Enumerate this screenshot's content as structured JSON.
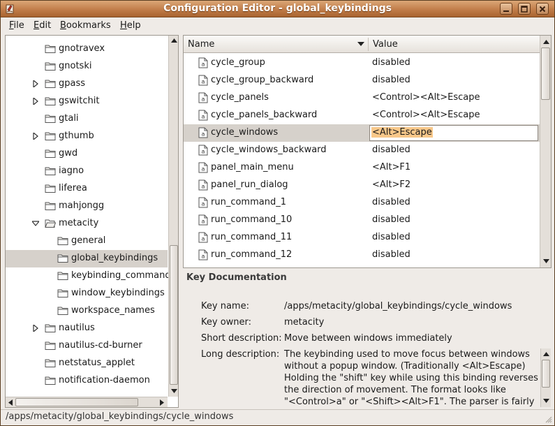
{
  "window": {
    "title": "Configuration Editor - global_keybindings"
  },
  "menubar": [
    {
      "mnemonic": "F",
      "rest": "ile"
    },
    {
      "mnemonic": "E",
      "rest": "dit"
    },
    {
      "mnemonic": "B",
      "rest": "ookmarks"
    },
    {
      "mnemonic": "H",
      "rest": "elp"
    }
  ],
  "tree": [
    {
      "label": "gnotravex",
      "level": 1,
      "expander": "none",
      "open": false,
      "selected": false
    },
    {
      "label": "gnotski",
      "level": 1,
      "expander": "none",
      "open": false,
      "selected": false
    },
    {
      "label": "gpass",
      "level": 1,
      "expander": "collapsed",
      "open": false,
      "selected": false
    },
    {
      "label": "gswitchit",
      "level": 1,
      "expander": "collapsed",
      "open": false,
      "selected": false
    },
    {
      "label": "gtali",
      "level": 1,
      "expander": "none",
      "open": false,
      "selected": false
    },
    {
      "label": "gthumb",
      "level": 1,
      "expander": "collapsed",
      "open": false,
      "selected": false
    },
    {
      "label": "gwd",
      "level": 1,
      "expander": "none",
      "open": false,
      "selected": false
    },
    {
      "label": "iagno",
      "level": 1,
      "expander": "none",
      "open": false,
      "selected": false
    },
    {
      "label": "liferea",
      "level": 1,
      "expander": "none",
      "open": false,
      "selected": false
    },
    {
      "label": "mahjongg",
      "level": 1,
      "expander": "none",
      "open": false,
      "selected": false
    },
    {
      "label": "metacity",
      "level": 1,
      "expander": "expanded",
      "open": true,
      "selected": false
    },
    {
      "label": "general",
      "level": 2,
      "expander": "none",
      "open": false,
      "selected": false
    },
    {
      "label": "global_keybindings",
      "level": 2,
      "expander": "none",
      "open": false,
      "selected": true
    },
    {
      "label": "keybinding_commands",
      "level": 2,
      "expander": "none",
      "open": false,
      "selected": false
    },
    {
      "label": "window_keybindings",
      "level": 2,
      "expander": "none",
      "open": false,
      "selected": false
    },
    {
      "label": "workspace_names",
      "level": 2,
      "expander": "none",
      "open": false,
      "selected": false
    },
    {
      "label": "nautilus",
      "level": 1,
      "expander": "collapsed",
      "open": false,
      "selected": false
    },
    {
      "label": "nautilus-cd-burner",
      "level": 1,
      "expander": "none",
      "open": false,
      "selected": false
    },
    {
      "label": "netstatus_applet",
      "level": 1,
      "expander": "none",
      "open": false,
      "selected": false
    },
    {
      "label": "notification-daemon",
      "level": 1,
      "expander": "none",
      "open": false,
      "selected": false
    }
  ],
  "list": {
    "columns": {
      "name": "Name",
      "value": "Value"
    },
    "rows": [
      {
        "name": "cycle_group",
        "value": "disabled",
        "selected": false
      },
      {
        "name": "cycle_group_backward",
        "value": "disabled",
        "selected": false
      },
      {
        "name": "cycle_panels",
        "value": "<Control><Alt>Escape",
        "selected": false
      },
      {
        "name": "cycle_panels_backward",
        "value": "<Control><Alt>Escape",
        "selected": false
      },
      {
        "name": "cycle_windows",
        "value": "<Alt>Escape",
        "selected": true
      },
      {
        "name": "cycle_windows_backward",
        "value": "disabled",
        "selected": false
      },
      {
        "name": "panel_main_menu",
        "value": "<Alt>F1",
        "selected": false
      },
      {
        "name": "panel_run_dialog",
        "value": "<Alt>F2",
        "selected": false
      },
      {
        "name": "run_command_1",
        "value": "disabled",
        "selected": false
      },
      {
        "name": "run_command_10",
        "value": "disabled",
        "selected": false
      },
      {
        "name": "run_command_11",
        "value": "disabled",
        "selected": false
      },
      {
        "name": "run_command_12",
        "value": "disabled",
        "selected": false
      }
    ]
  },
  "doc": {
    "title": "Key Documentation",
    "key_name_label": "Key name:",
    "key_name": "/apps/metacity/global_keybindings/cycle_windows",
    "key_owner_label": "Key owner:",
    "key_owner": "metacity",
    "short_desc_label": "Short description:",
    "short_desc": "Move between windows immediately",
    "long_desc_label": "Long description:",
    "long_desc_lines": [
      "The keybinding used to move focus between windows",
      "without a popup window. (Traditionally <Alt>Escape)",
      "Holding the \"shift\" key while using this binding reverses",
      "the direction of movement. The format looks like",
      "\"<Control>a\" or \"<Shift><Alt>F1\". The parser is fairly"
    ]
  },
  "status": "/apps/metacity/global_keybindings/cycle_windows",
  "colors": {
    "titlebar": "#c17d4a",
    "selection": "#d6d1cb",
    "edit_highlight": "#f8c88a"
  }
}
